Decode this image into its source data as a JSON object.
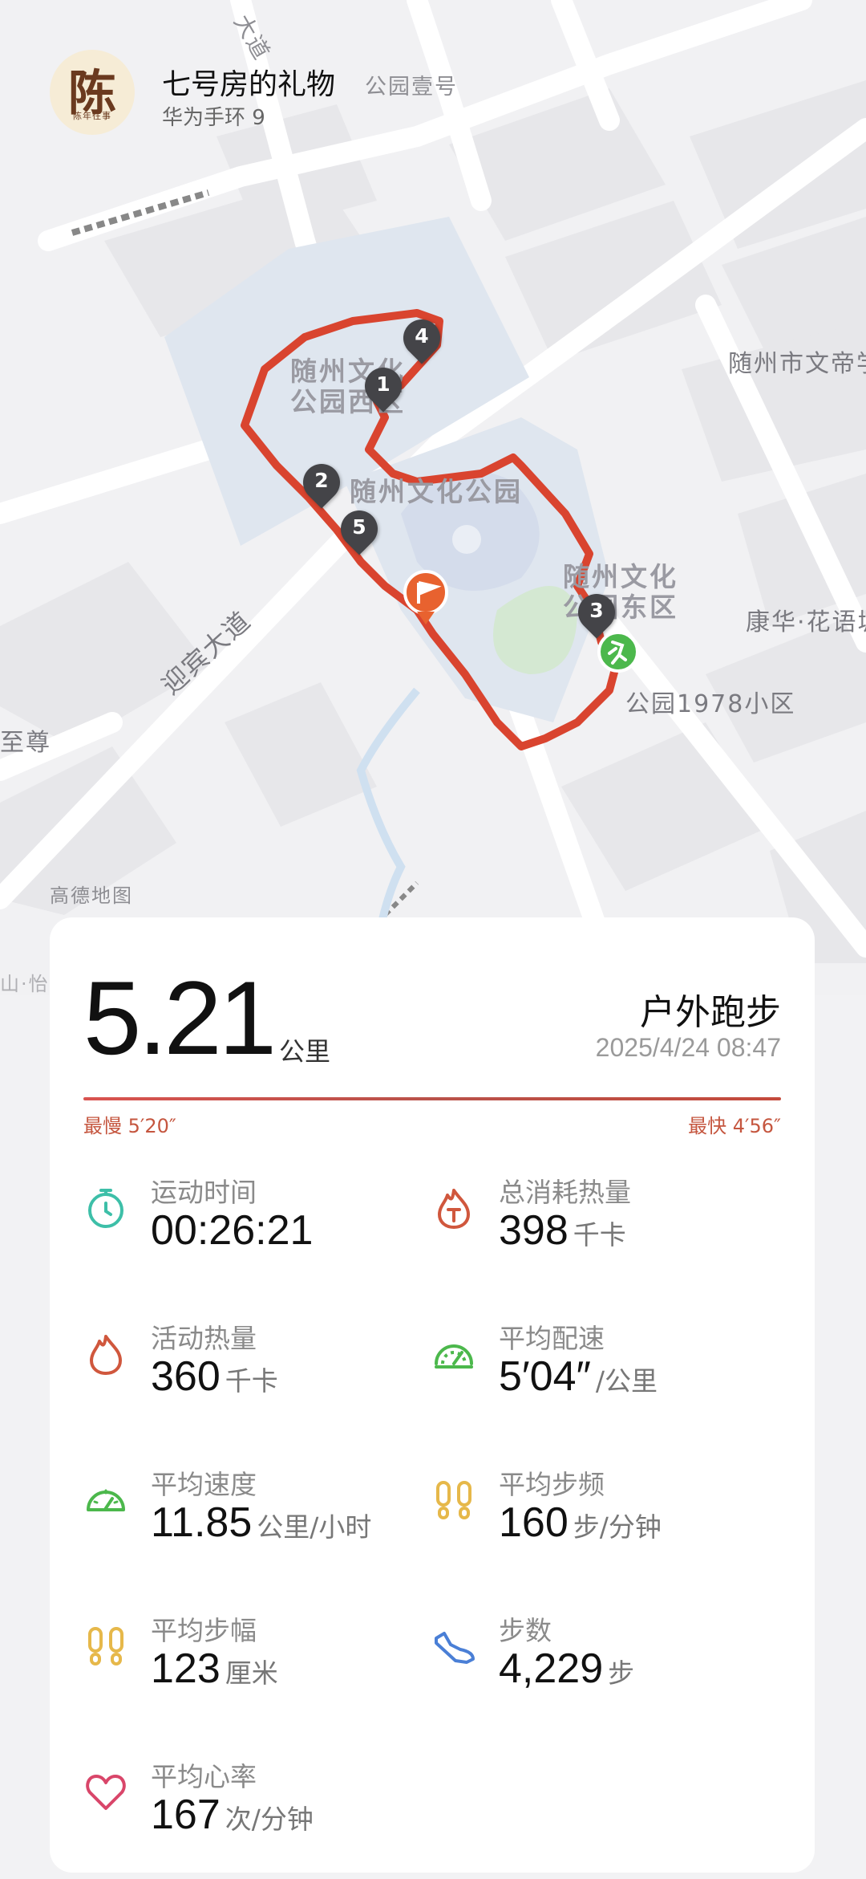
{
  "user": {
    "name": "七号房的礼物",
    "device": "华为手环 9",
    "avatar_text": "陈",
    "avatar_subtext": "陈年往事"
  },
  "map": {
    "labels": {
      "park_one": "公园壹号",
      "culture_school": "随州市文帝学",
      "kanghua": "康华·花语城",
      "park1978": "公园1978小区",
      "yingbin": "迎宾大道",
      "zhizun": "至尊",
      "amap": "高德地图",
      "shanyi": "山·怡",
      "road_top": "大道"
    },
    "parks": {
      "west": [
        "随州文化",
        "公园西区"
      ],
      "main": "随州文化公园",
      "east": [
        "随州文化",
        "公园东区"
      ]
    },
    "markers": [
      "1",
      "2",
      "3",
      "4",
      "5"
    ]
  },
  "summary": {
    "distance": "5.21",
    "distance_unit": "公里",
    "activity_type": "户外跑步",
    "datetime": "2025/4/24 08:47",
    "slowest": "最慢 5′20″",
    "fastest": "最快 4′56″"
  },
  "metrics": {
    "duration": {
      "label": "运动时间",
      "value": "00:26:21",
      "unit": ""
    },
    "total_calories": {
      "label": "总消耗热量",
      "value": "398",
      "unit": "千卡"
    },
    "active_calories": {
      "label": "活动热量",
      "value": "360",
      "unit": "千卡"
    },
    "avg_pace": {
      "label": "平均配速",
      "value": "5′04″",
      "unit": "/公里"
    },
    "avg_speed": {
      "label": "平均速度",
      "value": "11.85",
      "unit": "公里/小时"
    },
    "avg_cadence": {
      "label": "平均步频",
      "value": "160",
      "unit": "步/分钟"
    },
    "avg_stride": {
      "label": "平均步幅",
      "value": "123",
      "unit": "厘米"
    },
    "steps": {
      "label": "步数",
      "value": "4,229",
      "unit": "步"
    },
    "avg_heart_rate": {
      "label": "平均心率",
      "value": "167",
      "unit": "次/分钟"
    }
  },
  "colors": {
    "route": "#d9442f",
    "accent_red": "#c5563f",
    "teal": "#3dbfa8",
    "green": "#4cb84c",
    "yellow": "#e6b84a",
    "blue": "#4a7fd6",
    "pink": "#d9466a"
  }
}
